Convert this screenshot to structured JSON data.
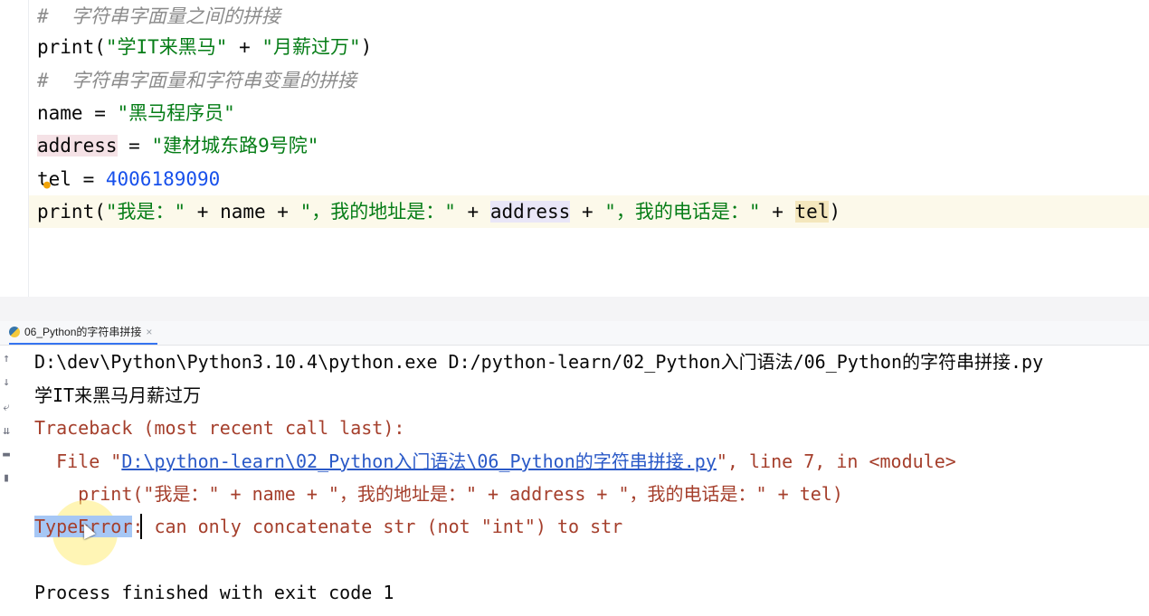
{
  "editor": {
    "comment_1": "#  字符串字面量之间的拼接",
    "line_print1": {
      "fn": "print(",
      "s1": "\"学IT来黑马\"",
      "op": " + ",
      "s2": "\"月薪过万\"",
      "close": ")"
    },
    "comment_2": "#  字符串字面量和字符串变量的拼接",
    "line_name": {
      "var": "name",
      "eq": " = ",
      "val": "\"黑马程序员\""
    },
    "line_address": {
      "var": "address",
      "eq": " = ",
      "val": "\"建材城东路9号院\""
    },
    "line_tel": {
      "var": "tel",
      "eq": " = ",
      "val": "4006189090"
    },
    "line_print2": {
      "fn": "print(",
      "s1": "\"我是：\"",
      "op1": " + name + ",
      "s2": "\"，我的地址是：\"",
      "op2": " + ",
      "addr": "address",
      "op3": " + ",
      "s3": "\"，我的电话是：\"",
      "op4": " + ",
      "tel": "tel",
      "close": ")"
    }
  },
  "run_panel": {
    "tab_label": "06_Python的字符串拼接",
    "tab_close": "×",
    "icons": [
      "up-arrow-icon",
      "down-arrow-icon",
      "soft-wrap-icon",
      "scroll-to-end-icon",
      "print-icon",
      "trash-icon"
    ]
  },
  "console": {
    "cmd": "D:\\dev\\Python\\Python3.10.4\\python.exe D:/python-learn/02_Python入门语法/06_Python的字符串拼接.py",
    "out1": "学IT来黑马月薪过万",
    "traceback": "Traceback (most recent call last):",
    "file_prefix": "  File \"",
    "file_link": "D:\\python-learn\\02_Python入门语法\\06_Python的字符串拼接.py",
    "file_suffix": "\", line 7, in <module>",
    "code_line": "    print(\"我是：\" + name + \"，我的地址是：\" + address + \"，我的电话是：\" + tel)",
    "error_type": "TypeError",
    "error_msg": ": can only concatenate str (not \"int\") to str",
    "finish": "Process finished with exit code 1"
  },
  "colors": {
    "string": "#067d17",
    "comment": "#8c8c8c",
    "number": "#1750eb",
    "error": "#a53f2c",
    "link": "#2a59c7",
    "selection": "#a6c7f5"
  }
}
